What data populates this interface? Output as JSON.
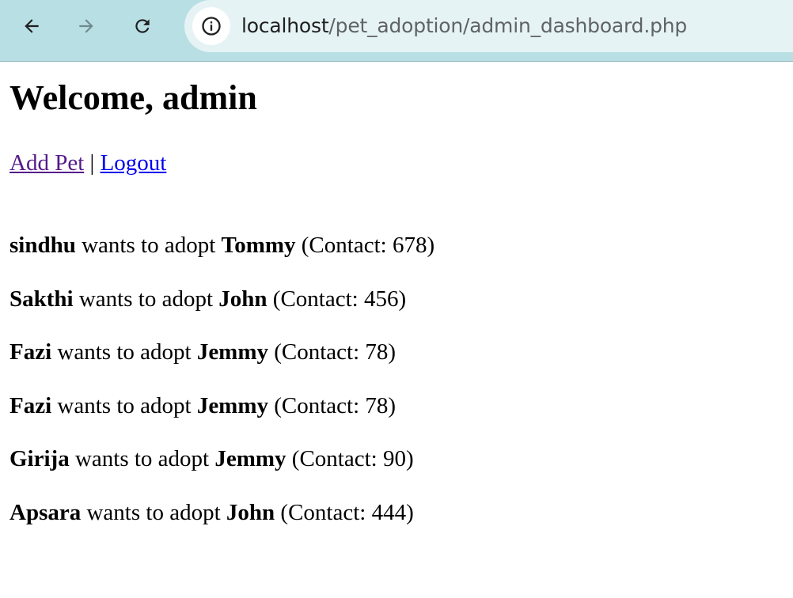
{
  "browser": {
    "back_icon": "arrow-left-icon",
    "forward_icon": "arrow-right-icon",
    "reload_icon": "reload-icon",
    "site_info_icon": "info-icon",
    "url_host": "localhost",
    "url_path": "/pet_adoption/admin_dashboard.php"
  },
  "page": {
    "heading": "Welcome, admin",
    "links": {
      "add_pet": "Add Pet",
      "separator": " | ",
      "logout": "Logout"
    },
    "request_text": {
      "wants": " wants to adopt ",
      "contact_prefix": " (Contact: ",
      "contact_suffix": ")"
    },
    "requests": [
      {
        "user": "sindhu",
        "pet": "Tommy",
        "contact": "678"
      },
      {
        "user": "Sakthi",
        "pet": "John",
        "contact": "456"
      },
      {
        "user": "Fazi",
        "pet": "Jemmy",
        "contact": "78"
      },
      {
        "user": "Fazi",
        "pet": "Jemmy",
        "contact": "78"
      },
      {
        "user": "Girija",
        "pet": "Jemmy",
        "contact": "90"
      },
      {
        "user": "Apsara",
        "pet": "John",
        "contact": "444"
      }
    ]
  },
  "colors": {
    "toolbar_bg": "#b8dfe4",
    "omnibox_bg": "#e6f3f5",
    "link_visited": "#551a8b",
    "link_unvisited": "#0000ee"
  }
}
